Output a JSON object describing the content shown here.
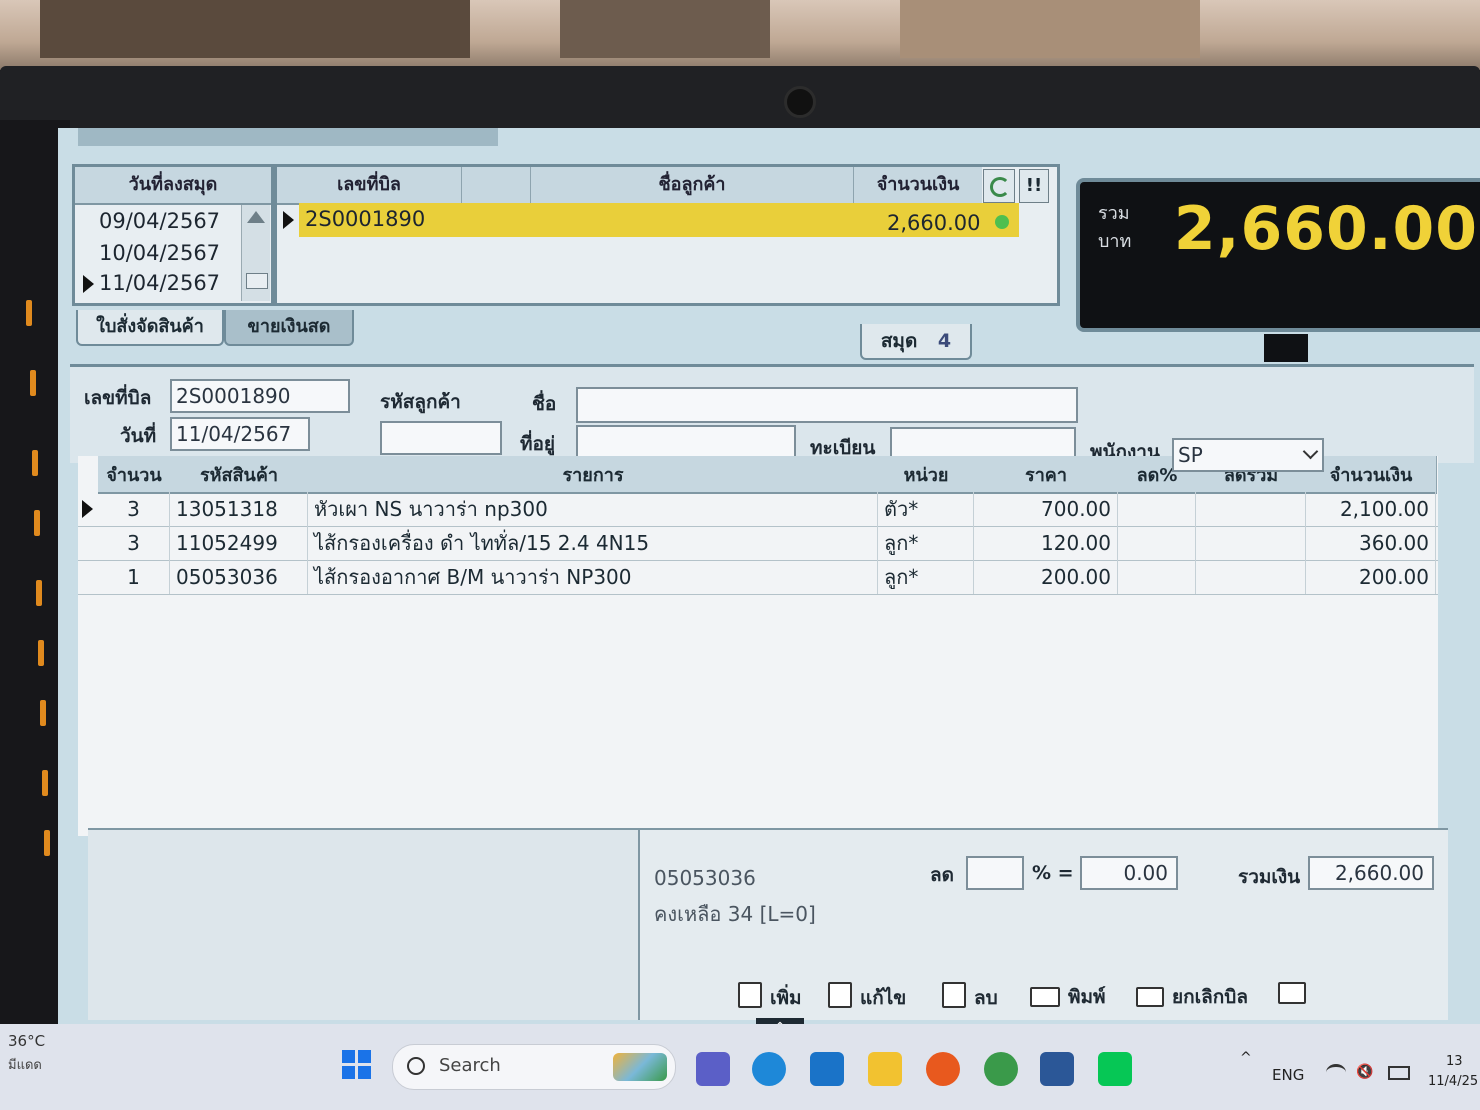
{
  "app": {
    "date_list": {
      "header": "วันที่ลงสมุด",
      "dates": [
        "09/04/2567",
        "10/04/2567",
        "11/04/2567"
      ]
    },
    "bill_list": {
      "headers": [
        "เลขที่บิล",
        "ชื่อลูกค้า",
        "จำนวนเงิน"
      ],
      "rows": [
        {
          "bill_no": "2S0001890",
          "customer": "",
          "amount": "2,660.00"
        }
      ],
      "refresh_label": "refresh",
      "stop_label": "!!"
    },
    "tabs": [
      "ใบสั่งจัดสินค้า",
      "ขายเงินสด"
    ],
    "book": {
      "label": "สมุด",
      "number": "4"
    },
    "total": {
      "label_top": "รวม",
      "label_bottom": "บาท",
      "value": "2,660.00"
    },
    "form": {
      "bill_no_label": "เลขที่บิล",
      "bill_no": "2S0001890",
      "date_label": "วันที่",
      "date": "11/04/2567",
      "customer_code_label": "รหัสลูกค้า",
      "customer_code": "",
      "name_label": "ชื่อ",
      "name": "",
      "address_label": "ที่อยู่",
      "address": "",
      "registration_label": "ทะเบียน",
      "registration": "",
      "employee_label": "พนักงาน",
      "employee": "SP"
    },
    "items": {
      "headers": [
        "จำนวน",
        "รหัสสินค้า",
        "รายการ",
        "หน่วย",
        "ราคา",
        "ลด%",
        "ลดรวม",
        "จำนวนเงิน"
      ],
      "rows": [
        {
          "qty": "3",
          "code": "13051318",
          "desc": "หัวเผา NS นาวาร่า np300",
          "unit": "ตัว*",
          "price": "700.00",
          "disc_pct": "",
          "disc_total": "",
          "amount": "2,100.00"
        },
        {
          "qty": "3",
          "code": "11052499",
          "desc": "ไส้กรองเครื่อง ดำ ไททั่ล/15 2.4 4N15",
          "unit": "ลูก*",
          "price": "120.00",
          "disc_pct": "",
          "disc_total": "",
          "amount": "360.00"
        },
        {
          "qty": "1",
          "code": "05053036",
          "desc": "ไส้กรองอากาศ B/M นาวาร่า NP300",
          "unit": "ลูก*",
          "price": "200.00",
          "disc_pct": "",
          "disc_total": "",
          "amount": "200.00"
        }
      ]
    },
    "footer": {
      "selected_code": "05053036",
      "stock_text": "คงเหลือ 34 [L=0]",
      "discount_label": "ลด",
      "discount_pct": "",
      "pct_symbol": "% =",
      "discount_value": "0.00",
      "grand_total_label": "รวมเงิน",
      "grand_total": "2,660.00"
    },
    "toolbar": {
      "add": "เพิ่ม",
      "edit": "แก้ไข",
      "delete": "ลบ",
      "print": "พิมพ์",
      "cancel_bill": "ยกเลิกบิล"
    }
  },
  "taskbar": {
    "weather_temp": "36°C",
    "weather_text": "มีแดด",
    "search_placeholder": "Search",
    "language": "ENG",
    "time": "13",
    "date": "11/4/25"
  },
  "colors": {
    "selected_row": "#e9cf3a",
    "total_text": "#f0d238",
    "panel_bg": "#c9dde6"
  }
}
